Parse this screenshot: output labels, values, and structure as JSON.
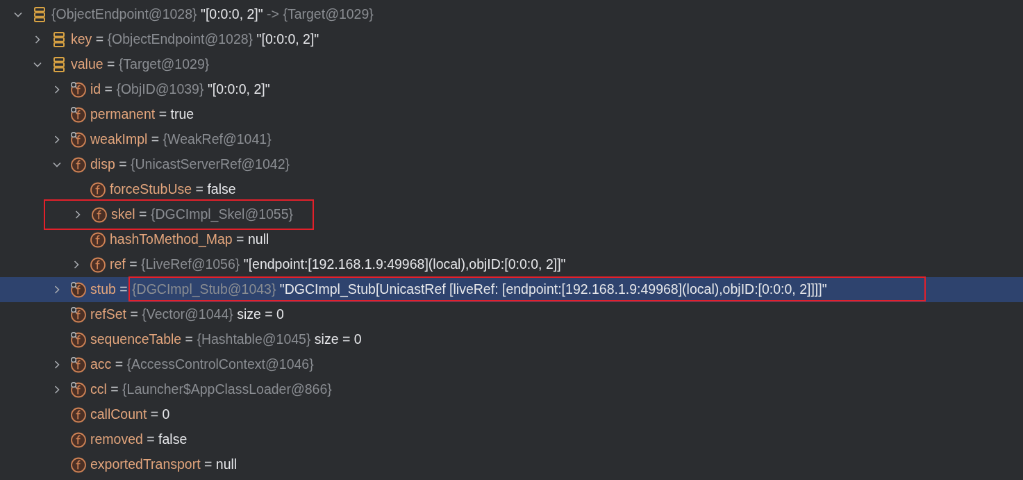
{
  "tree": [
    {
      "kind": "entry",
      "expanded": true,
      "selected": false,
      "parts": [
        {
          "text": "{ObjectEndpoint@1028}",
          "kind": "type"
        },
        {
          "text": " \"[0:0:0, 2]\"",
          "kind": "value"
        },
        {
          "text": " -> ",
          "kind": "type"
        },
        {
          "text": "{Target@1029}",
          "kind": "type"
        }
      ],
      "children": [
        {
          "kind": "entry",
          "expanded": false,
          "selected": false,
          "parts": [
            {
              "text": "key",
              "kind": "name"
            },
            {
              "text": " = ",
              "kind": "op"
            },
            {
              "text": "{ObjectEndpoint@1028}",
              "kind": "type"
            },
            {
              "text": " \"[0:0:0, 2]\"",
              "kind": "value"
            }
          ]
        },
        {
          "kind": "entry",
          "expanded": true,
          "selected": false,
          "parts": [
            {
              "text": "value",
              "kind": "name"
            },
            {
              "text": " = ",
              "kind": "op"
            },
            {
              "text": "{Target@1029}",
              "kind": "type"
            }
          ],
          "children": [
            {
              "kind": "field",
              "final": true,
              "expanded": false,
              "selected": false,
              "parts": [
                {
                  "text": "id",
                  "kind": "name"
                },
                {
                  "text": " = ",
                  "kind": "op"
                },
                {
                  "text": "{ObjID@1039}",
                  "kind": "type"
                },
                {
                  "text": " \"[0:0:0, 2]\"",
                  "kind": "value"
                }
              ]
            },
            {
              "kind": "field",
              "final": true,
              "selected": false,
              "parts": [
                {
                  "text": "permanent",
                  "kind": "name"
                },
                {
                  "text": " = ",
                  "kind": "op"
                },
                {
                  "text": "true",
                  "kind": "value"
                }
              ]
            },
            {
              "kind": "field",
              "final": true,
              "expanded": false,
              "selected": false,
              "parts": [
                {
                  "text": "weakImpl",
                  "kind": "name"
                },
                {
                  "text": " = ",
                  "kind": "op"
                },
                {
                  "text": "{WeakRef@1041}",
                  "kind": "type"
                }
              ]
            },
            {
              "kind": "field",
              "final": false,
              "expanded": true,
              "selected": false,
              "parts": [
                {
                  "text": "disp",
                  "kind": "name"
                },
                {
                  "text": " = ",
                  "kind": "op"
                },
                {
                  "text": "{UnicastServerRef@1042}",
                  "kind": "type"
                }
              ],
              "children": [
                {
                  "kind": "field",
                  "final": false,
                  "selected": false,
                  "parts": [
                    {
                      "text": "forceStubUse",
                      "kind": "name"
                    },
                    {
                      "text": " = ",
                      "kind": "op"
                    },
                    {
                      "text": "false",
                      "kind": "value"
                    }
                  ]
                },
                {
                  "kind": "field",
                  "final": false,
                  "expanded": false,
                  "selected": false,
                  "outlined": true,
                  "parts": [
                    {
                      "text": "skel",
                      "kind": "name"
                    },
                    {
                      "text": " = ",
                      "kind": "op"
                    },
                    {
                      "text": "{DGCImpl_Skel@1055}",
                      "kind": "type"
                    }
                  ]
                },
                {
                  "kind": "field",
                  "final": false,
                  "selected": false,
                  "parts": [
                    {
                      "text": "hashToMethod_Map",
                      "kind": "name"
                    },
                    {
                      "text": " = ",
                      "kind": "op"
                    },
                    {
                      "text": "null",
                      "kind": "value"
                    }
                  ]
                },
                {
                  "kind": "field",
                  "final": false,
                  "expanded": false,
                  "selected": false,
                  "parts": [
                    {
                      "text": "ref",
                      "kind": "name"
                    },
                    {
                      "text": " = ",
                      "kind": "op"
                    },
                    {
                      "text": "{LiveRef@1056}",
                      "kind": "type"
                    },
                    {
                      "text": " \"[endpoint:[192.168.1.9:49968](local),objID:[0:0:0, 2]]\"",
                      "kind": "value"
                    }
                  ]
                }
              ]
            },
            {
              "kind": "field",
              "final": true,
              "expanded": false,
              "selected": true,
              "parts": [
                {
                  "text": "stub",
                  "kind": "name"
                },
                {
                  "text": " = ",
                  "kind": "op"
                },
                {
                  "text": "{DGCImpl_Stub@1043}",
                  "kind": "type",
                  "outlined": true
                },
                {
                  "text": " \"DGCImpl_Stub[UnicastRef [liveRef: [endpoint:[192.168.1.9:49968](local),objID:[0:0:0, 2]]]]\"",
                  "kind": "value",
                  "outlined": true
                }
              ]
            },
            {
              "kind": "field",
              "final": true,
              "selected": false,
              "parts": [
                {
                  "text": "refSet",
                  "kind": "name"
                },
                {
                  "text": " = ",
                  "kind": "op"
                },
                {
                  "text": "{Vector@1044}",
                  "kind": "type"
                },
                {
                  "text": "  size = 0",
                  "kind": "value"
                }
              ]
            },
            {
              "kind": "field",
              "final": true,
              "selected": false,
              "parts": [
                {
                  "text": "sequenceTable",
                  "kind": "name"
                },
                {
                  "text": " = ",
                  "kind": "op"
                },
                {
                  "text": "{Hashtable@1045}",
                  "kind": "type"
                },
                {
                  "text": "  size = 0",
                  "kind": "value"
                }
              ]
            },
            {
              "kind": "field",
              "final": true,
              "expanded": false,
              "selected": false,
              "parts": [
                {
                  "text": "acc",
                  "kind": "name"
                },
                {
                  "text": " = ",
                  "kind": "op"
                },
                {
                  "text": "{AccessControlContext@1046}",
                  "kind": "type"
                }
              ]
            },
            {
              "kind": "field",
              "final": true,
              "expanded": false,
              "selected": false,
              "parts": [
                {
                  "text": "ccl",
                  "kind": "name"
                },
                {
                  "text": " = ",
                  "kind": "op"
                },
                {
                  "text": "{Launcher$AppClassLoader@866}",
                  "kind": "type"
                }
              ]
            },
            {
              "kind": "field",
              "final": false,
              "selected": false,
              "parts": [
                {
                  "text": "callCount",
                  "kind": "name"
                },
                {
                  "text": " = ",
                  "kind": "op"
                },
                {
                  "text": "0",
                  "kind": "value"
                }
              ]
            },
            {
              "kind": "field",
              "final": false,
              "selected": false,
              "parts": [
                {
                  "text": "removed",
                  "kind": "name"
                },
                {
                  "text": " = ",
                  "kind": "op"
                },
                {
                  "text": "false",
                  "kind": "value"
                }
              ]
            },
            {
              "kind": "field",
              "final": false,
              "selected": false,
              "parts": [
                {
                  "text": "exportedTransport",
                  "kind": "name"
                },
                {
                  "text": " = ",
                  "kind": "op"
                },
                {
                  "text": "null",
                  "kind": "value"
                }
              ]
            }
          ]
        }
      ]
    }
  ]
}
